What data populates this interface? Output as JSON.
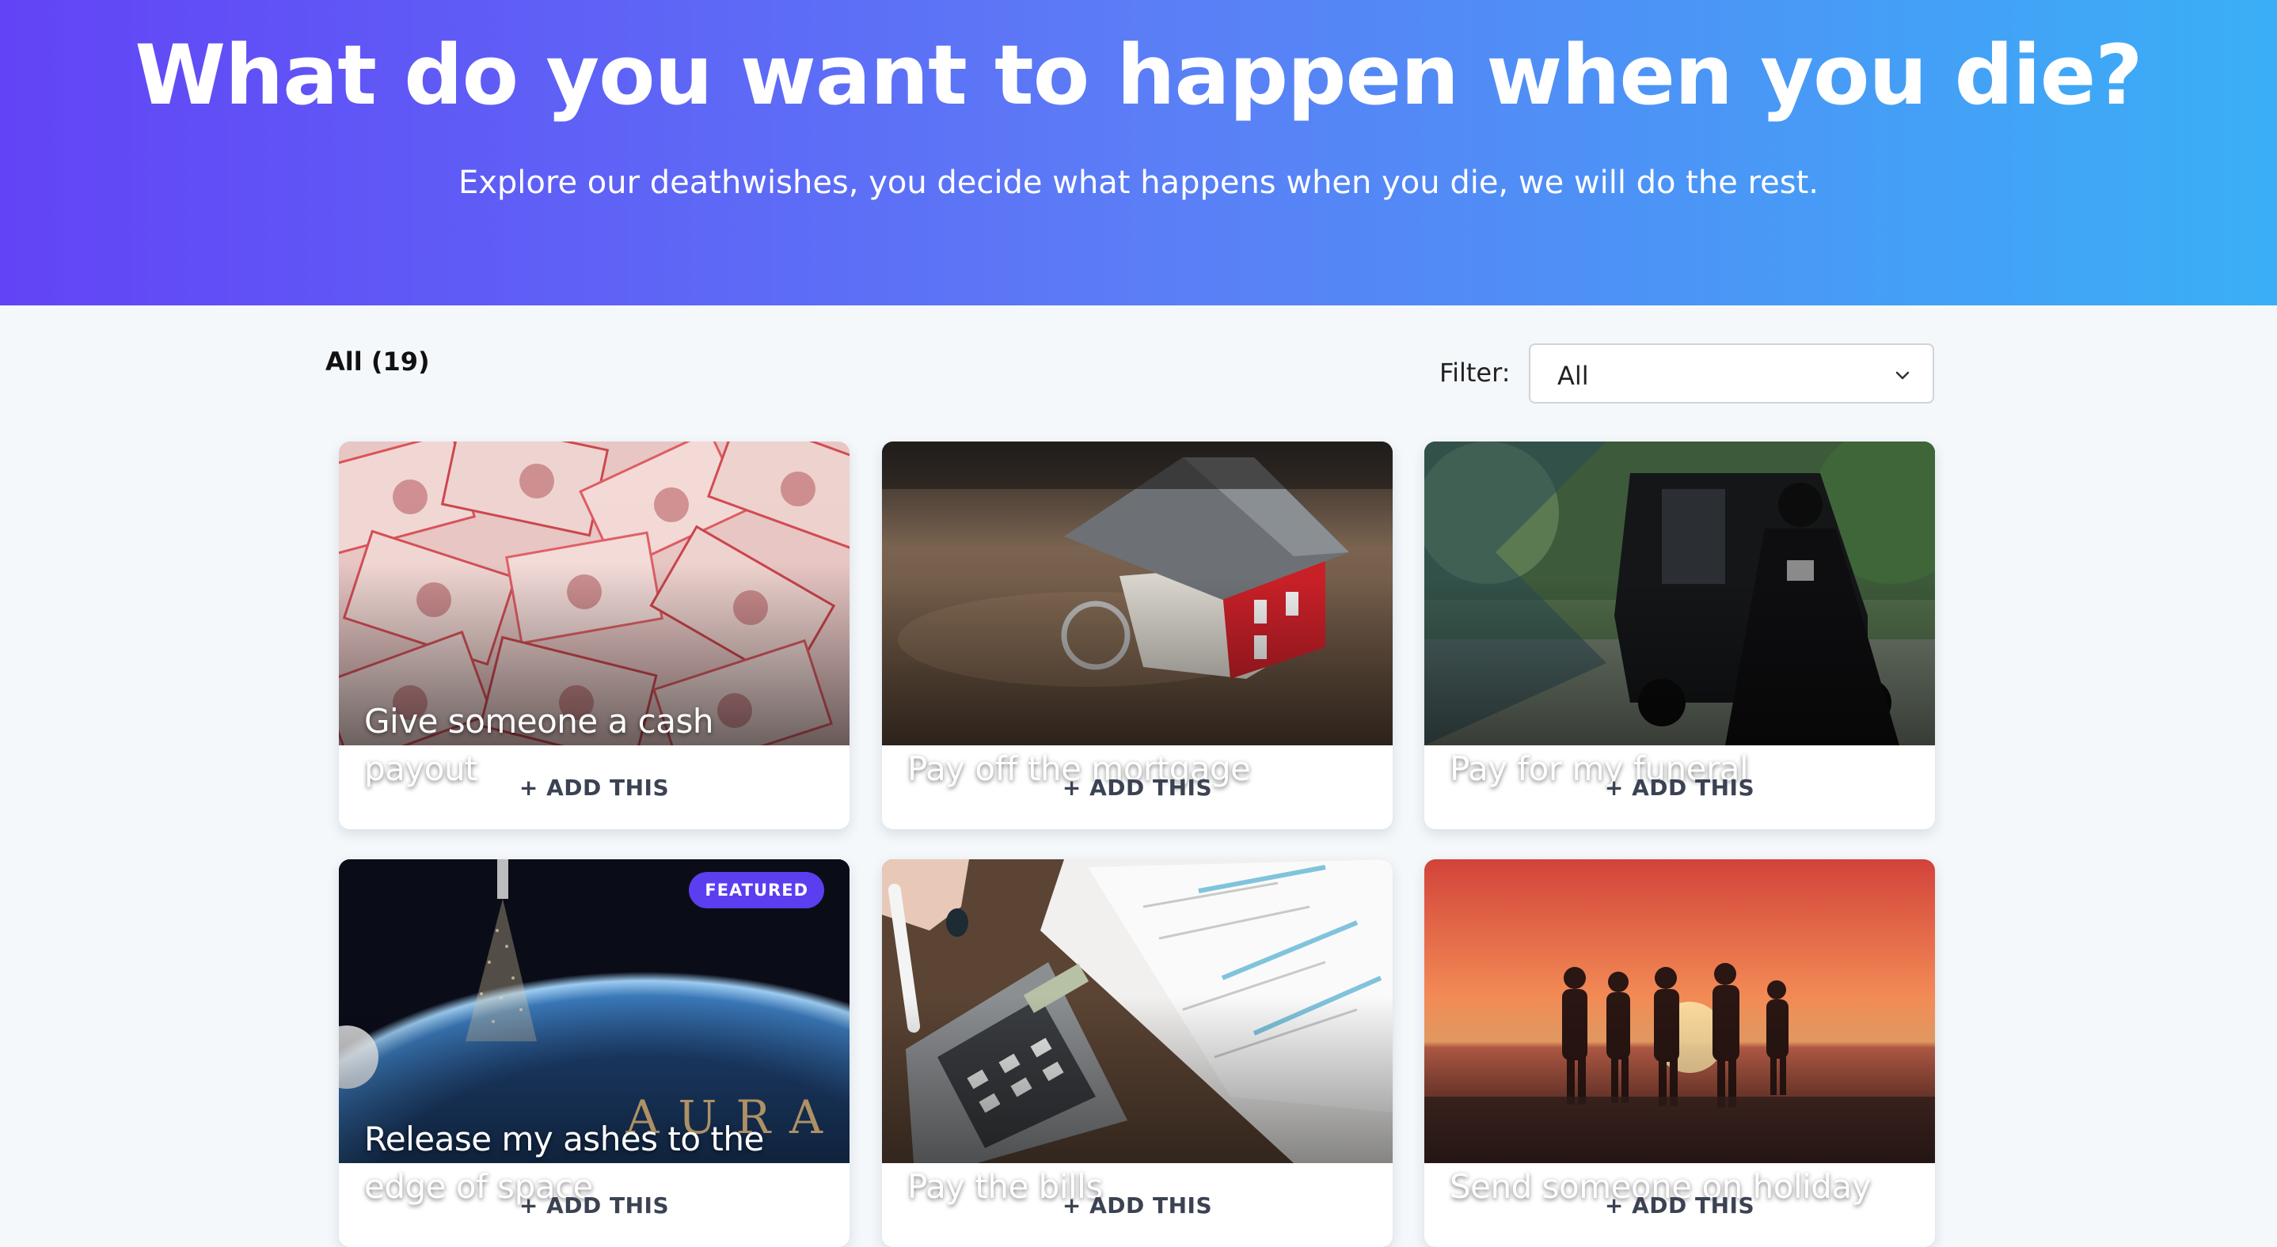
{
  "hero": {
    "title": "What do you want to happen when you die?",
    "subtitle": "Explore our deathwishes, you decide what happens when you die, we will do the rest."
  },
  "toolbar": {
    "count_label": "All (19)",
    "filter_label": "Filter:",
    "filter_selected": "All"
  },
  "cards": [
    {
      "title": "Give someone a cash payout",
      "action": "+ ADD THIS"
    },
    {
      "title": "Pay off the mortgage",
      "action": "+ ADD THIS"
    },
    {
      "title": "Pay for my funeral",
      "action": "+ ADD THIS"
    },
    {
      "title": "Release my ashes to the edge of space",
      "action": "+ ADD THIS",
      "badge": "FEATURED",
      "logo_text": "AURA"
    },
    {
      "title": "Pay the bills",
      "action": "+ ADD THIS"
    },
    {
      "title": "Send someone on holiday",
      "action": "+ ADD THIS"
    }
  ],
  "colors": {
    "hero_gradient_start": "#6244f6",
    "hero_gradient_end": "#3aaff6",
    "badge": "#5b3ef0",
    "page_background": "#f4f8fb"
  }
}
